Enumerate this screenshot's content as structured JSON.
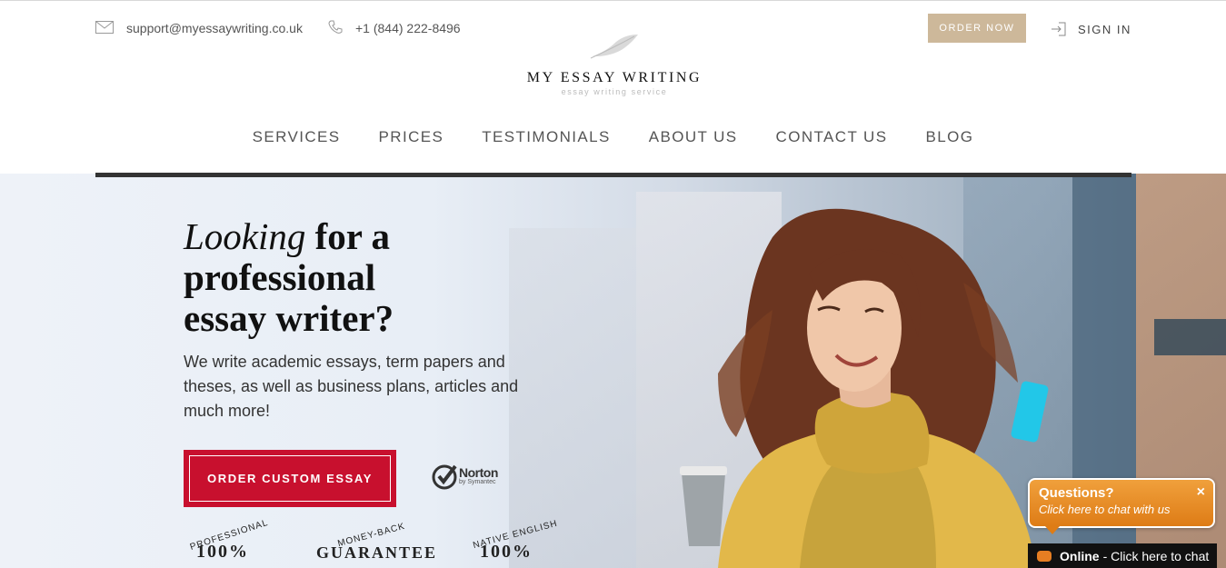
{
  "header": {
    "email": "support@myessaywriting.co.uk",
    "phone": "+1 (844) 222-8496",
    "order_now": "ORDER NOW",
    "sign_in": "SIGN IN",
    "logo_name": "MY ESSAY WRITING",
    "logo_tagline": "essay writing service"
  },
  "nav": {
    "items": [
      "SERVICES",
      "PRICES",
      "TESTIMONIALS",
      "ABOUT US",
      "CONTACT US",
      "BLOG"
    ]
  },
  "hero": {
    "headline_italic": "Looking",
    "headline_rest1": " for a",
    "headline_line2": "professional",
    "headline_line3": "essay writer?",
    "subtext": "We write academic essays, term papers and theses, as well as business plans, articles and much more!",
    "cta": "ORDER CUSTOM ESSAY",
    "norton_name": "Norton",
    "norton_sub": "by Symantec",
    "badges": [
      {
        "label": "PROFESSIONAL",
        "big": "100%"
      },
      {
        "label": "MONEY-BACK",
        "big": "GUARANTEE"
      },
      {
        "label": "NATIVE ENGLISH",
        "big": "100%"
      }
    ]
  },
  "chat": {
    "title": "Questions?",
    "subtitle": "Click here to chat with us",
    "close": "×",
    "status": "Online",
    "bar_text": "- Click here to chat"
  }
}
